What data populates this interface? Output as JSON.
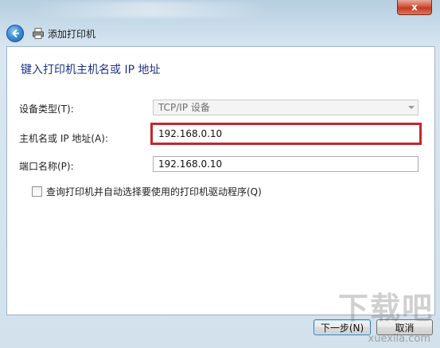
{
  "window": {
    "title": "添加打印机",
    "close_label": "x"
  },
  "page": {
    "heading": "键入打印机主机名或 IP 地址"
  },
  "form": {
    "device_type": {
      "label": "设备类型(T):",
      "value": "TCP/IP 设备"
    },
    "hostname": {
      "label": "主机名或 IP 地址(A):",
      "value": "192.168.0.10"
    },
    "port_name": {
      "label": "端口名称(P):",
      "value": "192.168.0.10"
    },
    "query_driver": {
      "label": "查询打印机并自动选择要使用的打印机驱动程序(Q)",
      "checked": false
    }
  },
  "buttons": {
    "next": "下一步(N)",
    "cancel": "取消"
  },
  "watermark": {
    "big": "下载吧",
    "small": "xuexila.com"
  },
  "colors": {
    "highlight": "#c4262e",
    "heading": "#1e3287"
  }
}
